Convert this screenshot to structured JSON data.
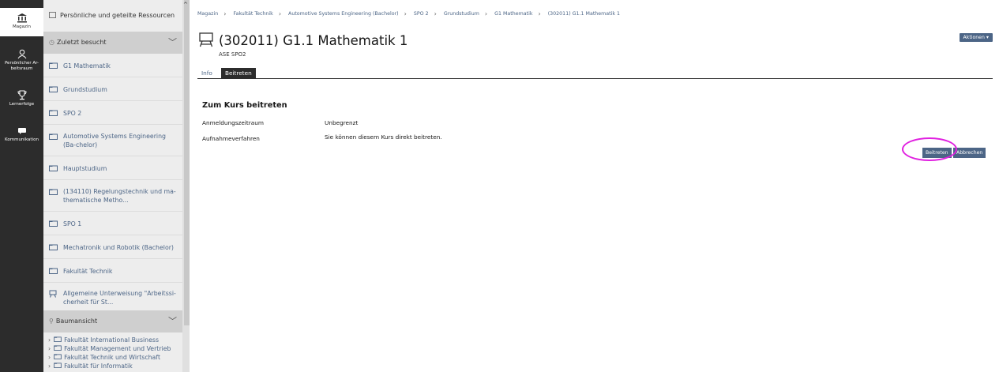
{
  "mainbar": {
    "items": [
      {
        "label": "Magazin",
        "icon": "repository-icon"
      },
      {
        "label": "Persönlicher Ar-beitsraum",
        "icon": "personal-workspace-icon"
      },
      {
        "label": "Lernerfolge",
        "icon": "trophy-icon"
      },
      {
        "label": "Kommunikation",
        "icon": "chat-icon"
      }
    ]
  },
  "slate": {
    "top_resource": "Persönliche und geteilte Ressourcen",
    "recent_header": "Zuletzt besucht",
    "recent_items": [
      "G1 Mathematik",
      "Grundstudium",
      "SPO 2",
      "Automotive Systems Engineering (Ba-chelor)",
      "Hauptstudium",
      "(134110) Regelungstechnik und ma-thematische Metho...",
      "SPO 1",
      "Mechatronik und Robotik (Bachelor)",
      "Fakultät Technik",
      "Allgemeine Unterweisung \"Arbeitssi-cherheit für St..."
    ],
    "tree_header": "Baumansicht",
    "tree_items": [
      "Fakultät International Business",
      "Fakultät Management und Vertrieb",
      "Fakultät Technik und Wirtschaft",
      "Fakultät für Informatik"
    ]
  },
  "breadcrumb": [
    "Magazin",
    "Fakultät Technik",
    "Automotive Systems Engineering (Bachelor)",
    "SPO 2",
    "Grundstudium",
    "G1 Mathematik",
    "(302011) G1.1 Mathematik 1"
  ],
  "header": {
    "title": "(302011) G1.1 Mathematik 1",
    "subtitle": "ASE SPO2",
    "actions_label": "Aktionen ▾"
  },
  "tabs": [
    {
      "label": "Info"
    },
    {
      "label": "Beitreten"
    }
  ],
  "join": {
    "section_title": "Zum Kurs beitreten",
    "rows": [
      {
        "label": "Anmeldungszeitraum",
        "value": "Unbegrenzt"
      },
      {
        "label": "Aufnahmeverfahren",
        "value": "Sie können diesem Kurs direkt beitreten."
      }
    ],
    "join_button": "Beitreten",
    "cancel_button": "Abbrechen"
  },
  "colors": {
    "mainbar": "#2c2c2c",
    "slate": "#ededed",
    "link": "#4c6586",
    "button": "#4c6586",
    "highlight": "#e020e0"
  }
}
